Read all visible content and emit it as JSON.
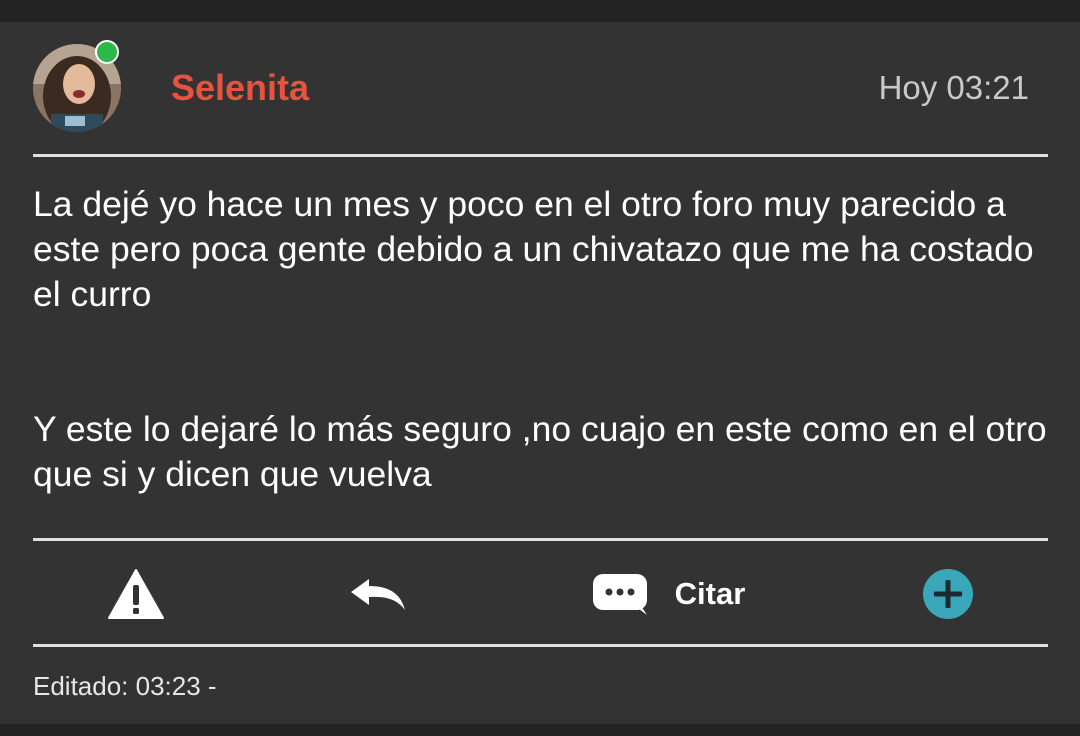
{
  "post": {
    "author": "Selenita",
    "timestamp": "Hoy 03:21",
    "online": true,
    "paragraphs": [
      "La dejé yo hace un mes y poco en el otro foro muy parecido a este pero poca gente debido a un chivatazo que me ha costado el curro",
      "Y este lo dejaré lo más seguro ,no cuajo en este como en el otro que si y dicen que vuelva"
    ],
    "edited": "Editado: 03:23 -"
  },
  "actions": {
    "report_icon": "warning-icon",
    "reply_icon": "reply-arrow-icon",
    "quote_icon": "speech-bubble-icon",
    "quote_label": "Citar",
    "more_icon": "plus-circle-icon"
  },
  "colors": {
    "background": "#333333",
    "username": "#e8533f",
    "online": "#2db84a",
    "accent": "#3aa6b9",
    "text": "#ffffff"
  }
}
